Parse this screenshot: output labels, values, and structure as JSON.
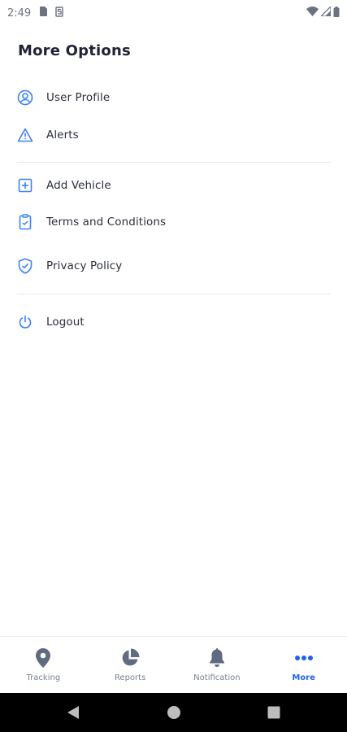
{
  "status_bar": {
    "time": "2:49",
    "icons": [
      "sim-card-icon",
      "s-notification-icon",
      "wifi-icon",
      "signal-icon",
      "battery-icon"
    ]
  },
  "page": {
    "title": "More Options"
  },
  "menu": {
    "items": [
      {
        "label": "User Profile",
        "icon": "user-circle-icon"
      },
      {
        "label": "Alerts",
        "icon": "warning-triangle-icon"
      },
      {
        "label": "Add Vehicle",
        "icon": "plus-square-icon"
      },
      {
        "label": "Terms and Conditions",
        "icon": "clipboard-icon"
      },
      {
        "label": "Privacy Policy",
        "icon": "shield-check-icon"
      },
      {
        "label": "Logout",
        "icon": "power-icon"
      }
    ]
  },
  "bottom_nav": {
    "items": [
      {
        "label": "Tracking",
        "icon": "location-pin-icon"
      },
      {
        "label": "Reports",
        "icon": "pie-chart-icon"
      },
      {
        "label": "Notification",
        "icon": "bell-icon"
      },
      {
        "label": "More",
        "icon": "more-dots-icon",
        "active": true
      }
    ]
  },
  "colors": {
    "accent": "#1e63e9",
    "nav_inactive": "#5f6b80",
    "icon_blue": "#3b82f6",
    "title": "#1e2235"
  }
}
